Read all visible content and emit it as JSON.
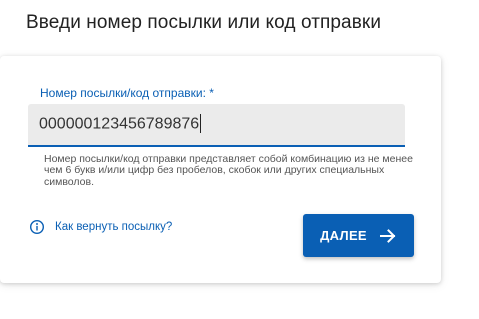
{
  "page": {
    "title": "Введи номер посылки или код отправки"
  },
  "form": {
    "label": "Номер посылки/код отправки: *",
    "value": "000000123456789876",
    "helper": "Номер посылки/код отправки представляет собой комбинацию из не менее чем 6 букв и/или цифр без пробелов, скобок или других специальных символов.",
    "info_icon": "info-icon",
    "help_link": "Как вернуть посылку?",
    "next_label": "ДАЛЕЕ",
    "next_icon": "arrow-right-icon"
  },
  "colors": {
    "accent": "#0a5fb4",
    "field_background": "#ebebeb",
    "title_text": "#222222",
    "helper_text": "#555555"
  }
}
